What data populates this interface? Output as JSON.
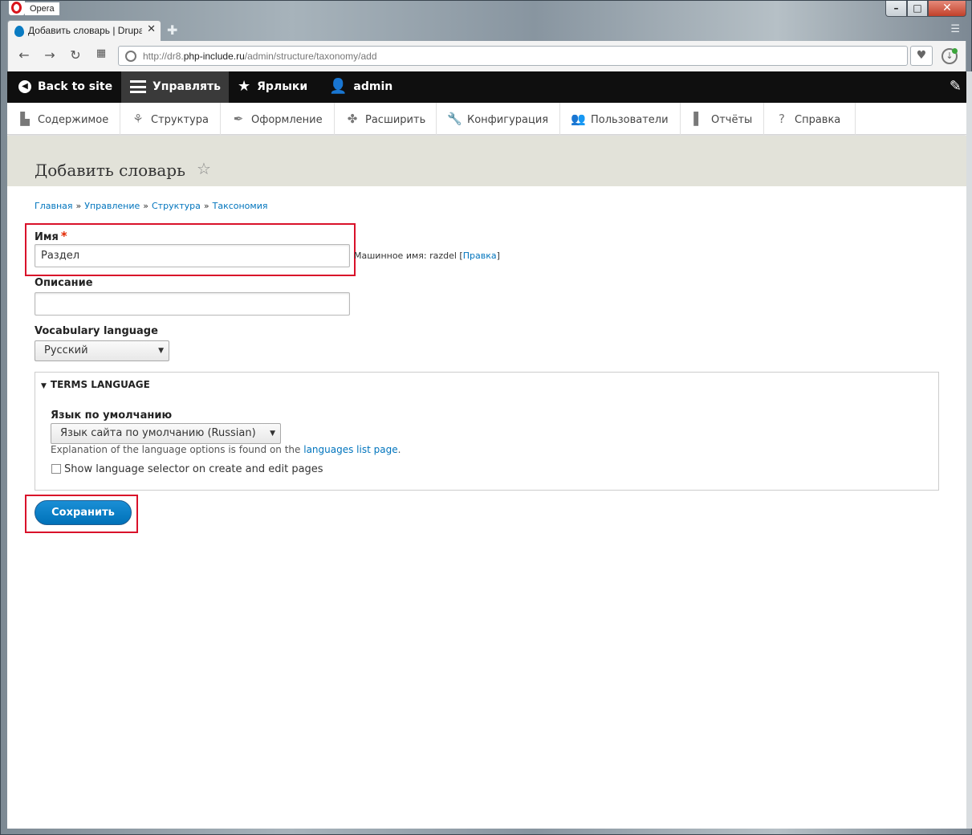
{
  "browser": {
    "app_name": "Opera",
    "tab_title": "Добавить словарь | Drupa",
    "url_prefix": "http://dr8.",
    "url_domain": "php-include.ru",
    "url_path": "/admin/structure/taxonomy/add"
  },
  "admin_bar": {
    "back": "Back to site",
    "manage": "Управлять",
    "shortcuts": "Ярлыки",
    "user": "admin"
  },
  "tray": [
    {
      "label": "Содержимое",
      "icon": "file-icon"
    },
    {
      "label": "Структура",
      "icon": "structure-icon"
    },
    {
      "label": "Оформление",
      "icon": "brush-icon"
    },
    {
      "label": "Расширить",
      "icon": "puzzle-icon"
    },
    {
      "label": "Конфигурация",
      "icon": "wrench-icon"
    },
    {
      "label": "Пользователи",
      "icon": "people-icon"
    },
    {
      "label": "Отчёты",
      "icon": "bar-chart-icon"
    },
    {
      "label": "Справка",
      "icon": "help-icon"
    }
  ],
  "page": {
    "title": "Добавить словарь",
    "breadcrumb": [
      "Главная",
      "Управление",
      "Структура",
      "Таксономия"
    ],
    "breadcrumb_sep": "»"
  },
  "form": {
    "name_label": "Имя",
    "required_mark": "*",
    "name_value": "Раздел",
    "machine_name_text": "Машинное имя: razdel",
    "machine_name_link": "Правка",
    "description_label": "Описание",
    "description_value": "",
    "vocab_lang_label": "Vocabulary language",
    "vocab_lang_value": "Русский",
    "fieldset_title": "Terms language",
    "default_lang_label": "Язык по умолчанию",
    "default_lang_value": "Язык сайта по умолчанию (Russian)",
    "explanation_text": "Explanation of the language options is found on the",
    "explanation_link": "languages list page",
    "explanation_end": ".",
    "show_selector_label": "Show language selector on create and edit pages",
    "show_selector_checked": false,
    "save_label": "Сохранить"
  },
  "colors": {
    "accent": "#0074bd",
    "highlight": "#d9112a",
    "admin_bar": "#0f0f0f"
  }
}
